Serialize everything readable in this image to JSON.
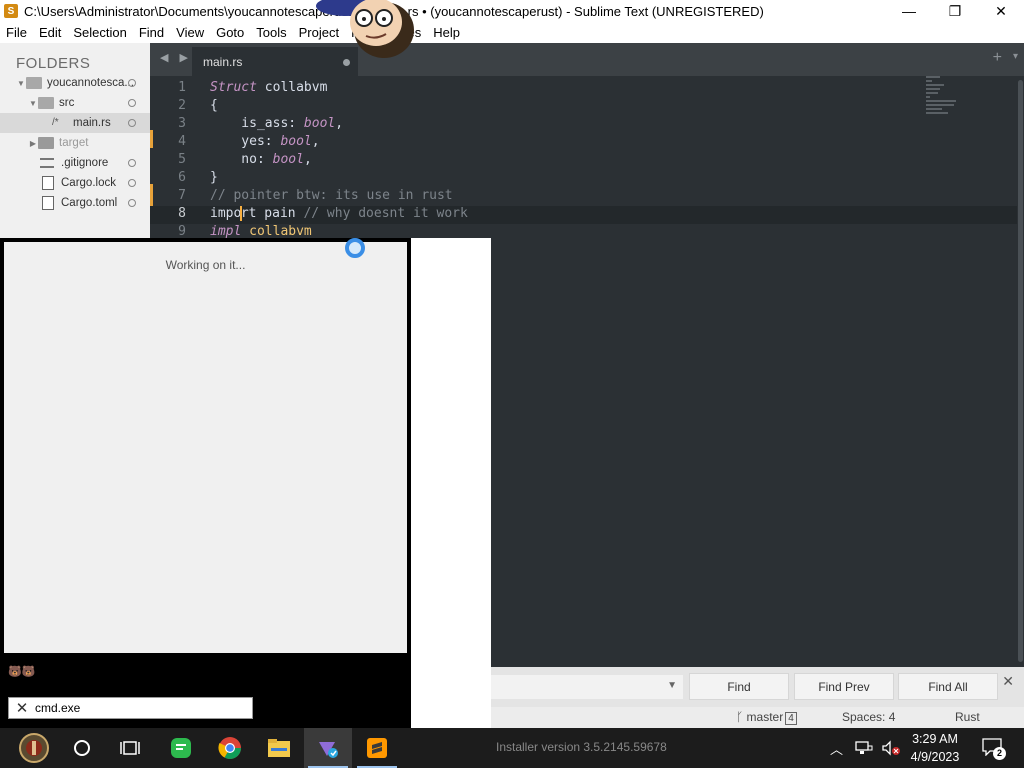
{
  "window": {
    "title": "C:\\Users\\Administrator\\Documents\\youcannotescaperust\\src\\main.rs • (youcannotescaperust) - Sublime Text (UNREGISTERED)",
    "minimize": "—",
    "maximize": "❐",
    "close": "✕"
  },
  "menu": [
    "File",
    "Edit",
    "Selection",
    "Find",
    "View",
    "Goto",
    "Tools",
    "Project",
    "Preferences",
    "Help"
  ],
  "sidebar": {
    "title": "FOLDERS",
    "items": [
      {
        "label": "youcannotesca...",
        "icon": "folder-open-icon"
      },
      {
        "label": "src",
        "icon": "folder-open-icon"
      },
      {
        "label": "main.rs",
        "icon": "rust-file-icon"
      },
      {
        "label": "target",
        "icon": "folder-icon"
      },
      {
        "label": ".gitignore",
        "icon": "text-file-icon"
      },
      {
        "label": "Cargo.lock",
        "icon": "file-icon"
      },
      {
        "label": "Cargo.toml",
        "icon": "file-icon"
      }
    ]
  },
  "tabs": {
    "nav_label": "◀ ▶",
    "active_tab": "main.rs",
    "plus": "+",
    "chevron": "▾"
  },
  "editor": {
    "lines": [
      {
        "n": "1",
        "tokens": [
          {
            "t": "Struct",
            "c": "kw"
          },
          {
            "t": " collabvm",
            "c": "plain"
          }
        ]
      },
      {
        "n": "2",
        "tokens": [
          {
            "t": "{",
            "c": "punct"
          }
        ]
      },
      {
        "n": "3",
        "tokens": [
          {
            "t": "    is_ass: ",
            "c": "plain"
          },
          {
            "t": "bool",
            "c": "ty"
          },
          {
            "t": ",",
            "c": "plain"
          }
        ]
      },
      {
        "n": "4",
        "tokens": [
          {
            "t": "    yes: ",
            "c": "plain"
          },
          {
            "t": "bool",
            "c": "ty"
          },
          {
            "t": ",",
            "c": "plain"
          }
        ]
      },
      {
        "n": "5",
        "tokens": [
          {
            "t": "    no: ",
            "c": "plain"
          },
          {
            "t": "bool",
            "c": "ty"
          },
          {
            "t": ",",
            "c": "plain"
          }
        ]
      },
      {
        "n": "6",
        "tokens": [
          {
            "t": "}",
            "c": "punct"
          }
        ]
      },
      {
        "n": "7",
        "tokens": [
          {
            "t": "// pointer btw: its use in rust",
            "c": "cmt"
          }
        ]
      },
      {
        "n": "8",
        "tokens": [
          {
            "t": "impo",
            "c": "plain"
          },
          {
            "t": "|",
            "c": "cursor"
          },
          {
            "t": "rt pain ",
            "c": "plain"
          },
          {
            "t": "// why doesnt it work",
            "c": "cmt"
          }
        ]
      },
      {
        "n": "9",
        "tokens": [
          {
            "t": "impl",
            "c": "kw"
          },
          {
            "t": " collabvm",
            "c": "nm"
          }
        ]
      }
    ]
  },
  "progress": {
    "message": "Working on it..."
  },
  "cmd": {
    "emoji": "🐻🐻",
    "close": "✕",
    "value": "cmd.exe"
  },
  "findbar": {
    "dropdown": "▼",
    "find": "Find",
    "find_prev": "Find Prev",
    "find_all": "Find All",
    "close": "✕"
  },
  "statusbar": {
    "branch": "master",
    "branch_count": "4",
    "spaces": "Spaces: 4",
    "syntax": "Rust"
  },
  "taskbar": {
    "installer_text": "Installer version 3.5.2145.59678",
    "time": "3:29 AM",
    "date": "4/9/2023",
    "notification_count": "2"
  }
}
